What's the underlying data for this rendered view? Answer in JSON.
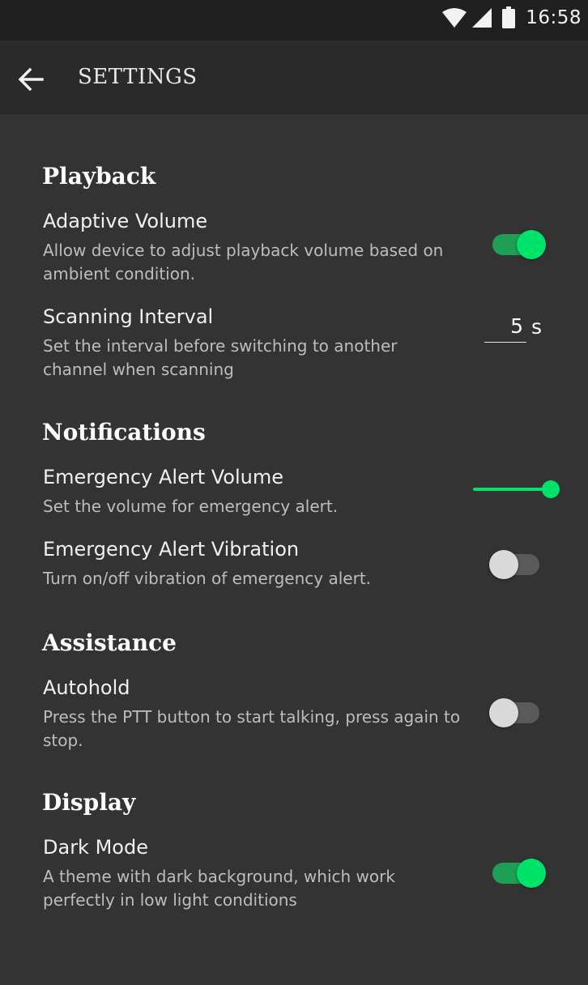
{
  "status_bar": {
    "time": "16:58",
    "icons": [
      "wifi-icon",
      "cell-signal-icon",
      "battery-icon"
    ]
  },
  "app_bar": {
    "title": "SETTINGS",
    "back_icon": "arrow-left-icon"
  },
  "colors": {
    "accent": "#00e36b",
    "background": "#333333",
    "app_bar": "#2a2a2a",
    "status_bar": "#202020"
  },
  "sections": {
    "playback": {
      "title": "Playback",
      "adaptive_volume": {
        "title": "Adaptive Volume",
        "description": "Allow device to adjust playback volume based on ambient condition.",
        "enabled": true
      },
      "scanning_interval": {
        "title": "Scanning Interval",
        "description": "Set the interval before switching to another channel when scanning",
        "value": "5",
        "unit": "s"
      }
    },
    "notifications": {
      "title": "Notifications",
      "emergency_volume": {
        "title": "Emergency Alert Volume",
        "description": "Set the volume for emergency alert.",
        "level": 1.0
      },
      "emergency_vibration": {
        "title": "Emergency Alert Vibration",
        "description": "Turn on/off vibration of emergency alert.",
        "enabled": false
      }
    },
    "assistance": {
      "title": "Assistance",
      "autohold": {
        "title": "Autohold",
        "description": "Press the PTT button to start talking, press again to stop.",
        "enabled": false
      }
    },
    "display": {
      "title": "Display",
      "dark_mode": {
        "title": "Dark Mode",
        "description": "A theme with dark background, which work perfectly in low light conditions",
        "enabled": true
      }
    }
  }
}
